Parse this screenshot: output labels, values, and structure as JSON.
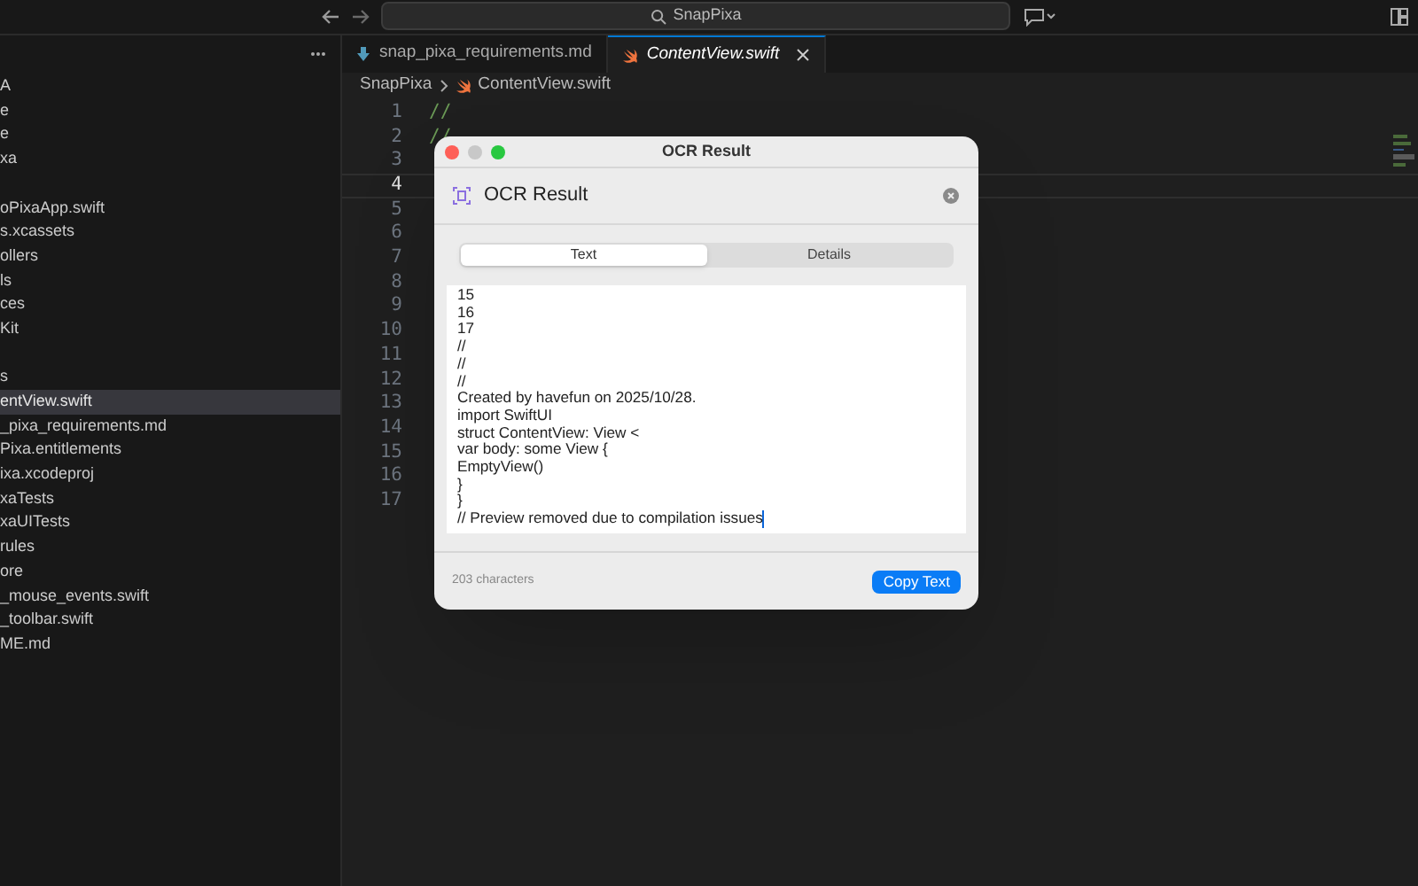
{
  "toolbar": {
    "search": "SnapPixa"
  },
  "sidebar": {
    "items": [
      {
        "label": "A",
        "selected": false
      },
      {
        "label": "e",
        "selected": false
      },
      {
        "label": "e",
        "selected": false
      },
      {
        "label": "xa",
        "selected": false
      },
      {
        "label": "oPixaApp.swift",
        "selected": false
      },
      {
        "label": "s.xcassets",
        "selected": false
      },
      {
        "label": "ollers",
        "selected": false
      },
      {
        "label": "ls",
        "selected": false
      },
      {
        "label": "ces",
        "selected": false
      },
      {
        "label": "Kit",
        "selected": false
      },
      {
        "label": "s",
        "selected": false
      },
      {
        "label": "entView.swift",
        "selected": true
      },
      {
        "label": "_pixa_requirements.md",
        "selected": false
      },
      {
        "label": "Pixa.entitlements",
        "selected": false
      },
      {
        "label": "ixa.xcodeproj",
        "selected": false
      },
      {
        "label": "xaTests",
        "selected": false
      },
      {
        "label": "xaUITests",
        "selected": false
      },
      {
        "label": "rules",
        "selected": false
      },
      {
        "label": "ore",
        "selected": false
      },
      {
        "label": "_mouse_events.swift",
        "selected": false
      },
      {
        "label": "_toolbar.swift",
        "selected": false
      },
      {
        "label": "ME.md",
        "selected": false
      }
    ]
  },
  "tabs": [
    {
      "label": "snap_pixa_requirements.md",
      "kind": "markdown",
      "selected": false
    },
    {
      "label": "ContentView.swift",
      "kind": "swift",
      "selected": true
    }
  ],
  "breadcrumb": [
    "SnapPixa",
    "ContentView.swift"
  ],
  "editor": {
    "lines": [
      {
        "number": "1",
        "code": "//",
        "current": false
      },
      {
        "number": "2",
        "code": "//",
        "current": false
      },
      {
        "number": "3",
        "current": false
      },
      {
        "number": "4",
        "current": true
      },
      {
        "number": "5",
        "current": false
      },
      {
        "number": "6",
        "current": false
      },
      {
        "number": "7",
        "current": false
      },
      {
        "number": "8",
        "current": false
      },
      {
        "number": "9",
        "current": false
      },
      {
        "number": "10",
        "current": false
      },
      {
        "number": "11",
        "current": false
      },
      {
        "number": "12",
        "current": false
      },
      {
        "number": "13",
        "current": false
      },
      {
        "number": "14",
        "current": false
      },
      {
        "number": "15",
        "current": false
      },
      {
        "number": "16",
        "current": false
      },
      {
        "number": "17",
        "current": false
      }
    ]
  },
  "dialog": {
    "window_title": "OCR Result",
    "heading": "OCR Result",
    "segments": [
      {
        "label": "Text",
        "selected": true
      },
      {
        "label": "Details",
        "selected": false
      }
    ],
    "text_lines": [
      "15",
      "16",
      "17",
      "//",
      "//",
      "//",
      "Created by havefun on 2025/10/28.",
      "import SwiftUI",
      "struct ContentView: View <",
      "var body: some View {",
      "EmptyView()",
      "}",
      "}",
      "// Preview removed due to compilation issues"
    ],
    "char_count": "203 characters",
    "copy_button": "Copy Text"
  }
}
